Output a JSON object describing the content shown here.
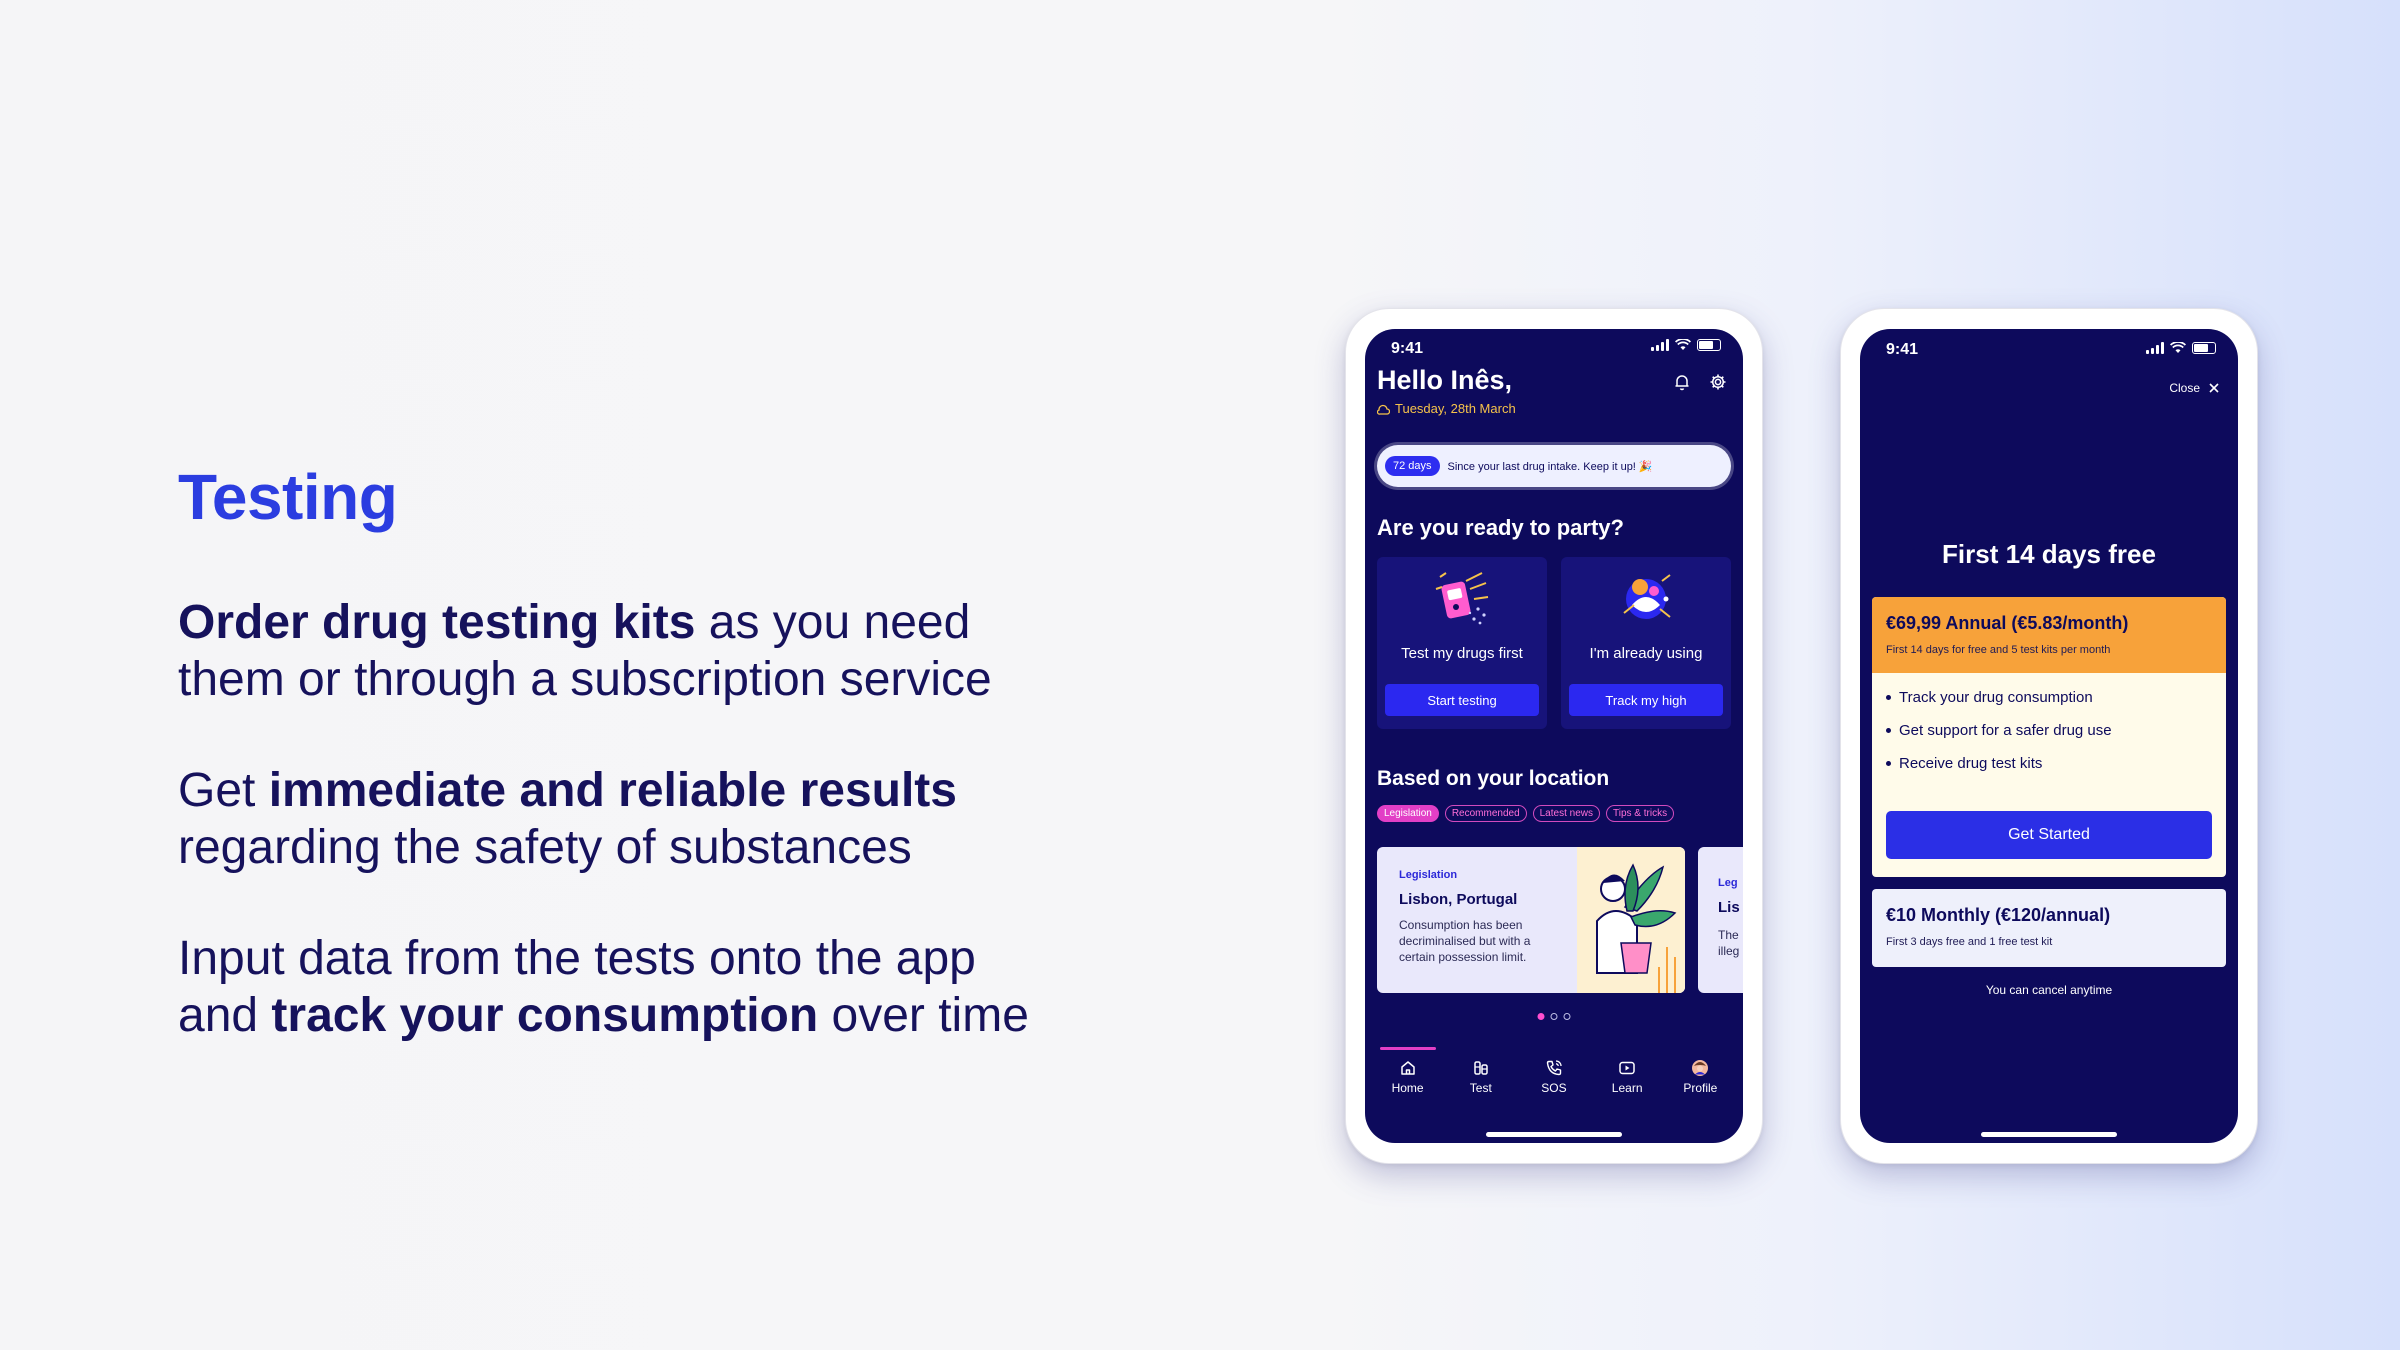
{
  "copy": {
    "title": "Testing",
    "p1_bold": "Order drug testing kits",
    "p1_rest_a": " as you need",
    "p1_rest_b": "them or through a subscription service",
    "p2_lead": "Get ",
    "p2_bold": "immediate and reliable results",
    "p2_rest": "regarding the safety of substances",
    "p3_a": "Input data from the tests onto the app",
    "p3_b": "and ",
    "p3_bold": "track your consumption",
    "p3_c": " over time"
  },
  "phone1": {
    "time": "9:41",
    "greeting": "Hello Inês,",
    "date": "Tuesday, 28th March",
    "streak_badge": "72 days",
    "streak_text": "Since your last drug intake. Keep it up! 🎉",
    "section1": "Are you ready to party?",
    "card1_title": "Test my drugs first",
    "card1_button": "Start testing",
    "card2_title": "I'm already using",
    "card2_button": "Track my high",
    "section2": "Based on your location",
    "chips": [
      "Legislation",
      "Recommended",
      "Latest news",
      "Tips & tricks"
    ],
    "news": {
      "tag": "Legislation",
      "title": "Lisbon, Portugal",
      "desc": "Consumption has been decriminalised but with a certain possession limit."
    },
    "news2": {
      "tag": "Leg",
      "title": "Lis",
      "desc": "The illeg"
    },
    "tabs": [
      "Home",
      "Test",
      "SOS",
      "Learn",
      "Profile"
    ]
  },
  "phone2": {
    "time": "9:41",
    "close": "Close",
    "title": "First 14 days free",
    "plan1_title": "€69,99 Annual (€5.83/month)",
    "plan1_sub": "First 14 days for free and 5 test kits per month",
    "benefits": [
      "Track your drug consumption",
      "Get support for a safer drug use",
      "Receive drug test kits"
    ],
    "cta": "Get Started",
    "plan2_title": "€10 Monthly (€120/annual)",
    "plan2_sub": "First 3 days free and 1 free test kit",
    "cancel": "You can cancel anytime"
  },
  "colors": {
    "accent_blue": "#2b3de0",
    "navy": "#0d0a5c",
    "pink": "#e23fc6",
    "orange": "#f7a23a",
    "date_yellow": "#f6c34a"
  },
  "icons": {
    "bell": "bell-icon",
    "settings": "gear-icon",
    "close": "close-icon",
    "tab_home": "home-icon",
    "tab_test": "test-icon",
    "tab_sos": "phone-icon",
    "tab_learn": "play-icon",
    "tab_profile": "avatar-icon"
  }
}
